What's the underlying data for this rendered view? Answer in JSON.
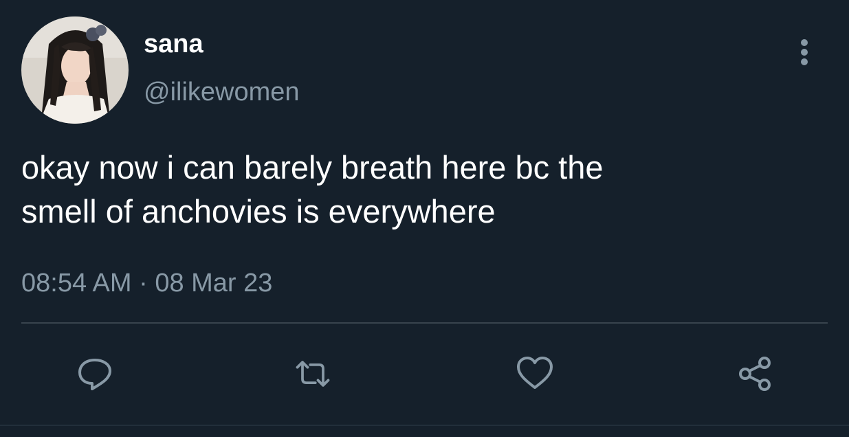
{
  "user": {
    "display_name": "sana",
    "handle": "@ilikewomen",
    "avatar_icon": "profile-photo"
  },
  "tweet": {
    "lines": [
      "okay now i can barely breath here bc the",
      "smell of anchovies is everywhere"
    ],
    "timestamp": "08:54 AM · 08 Mar 23"
  },
  "icons": {
    "more": "more-vertical-icon",
    "reply": "reply-icon",
    "retweet": "retweet-icon",
    "like": "heart-icon",
    "share": "share-icon"
  },
  "colors": {
    "background": "#15202b",
    "primary_text": "#ffffff",
    "secondary_text": "#8899a6",
    "divider": "#38444d"
  }
}
